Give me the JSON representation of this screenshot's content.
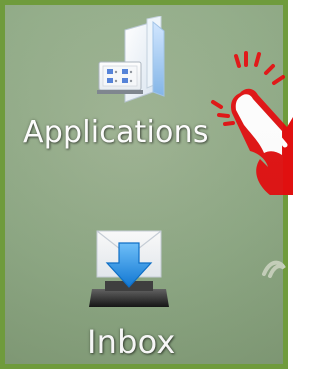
{
  "desktop": {
    "background_color": "#8ea984",
    "border_color": "#6f9b3c",
    "shortcuts": [
      {
        "label": "Applications",
        "icon": "applications-folder-icon"
      },
      {
        "label": "Inbox",
        "icon": "inbox-tray-icon"
      }
    ]
  },
  "cursor": {
    "icon": "pointing-hand-cursor-icon",
    "color": "#e01010"
  }
}
